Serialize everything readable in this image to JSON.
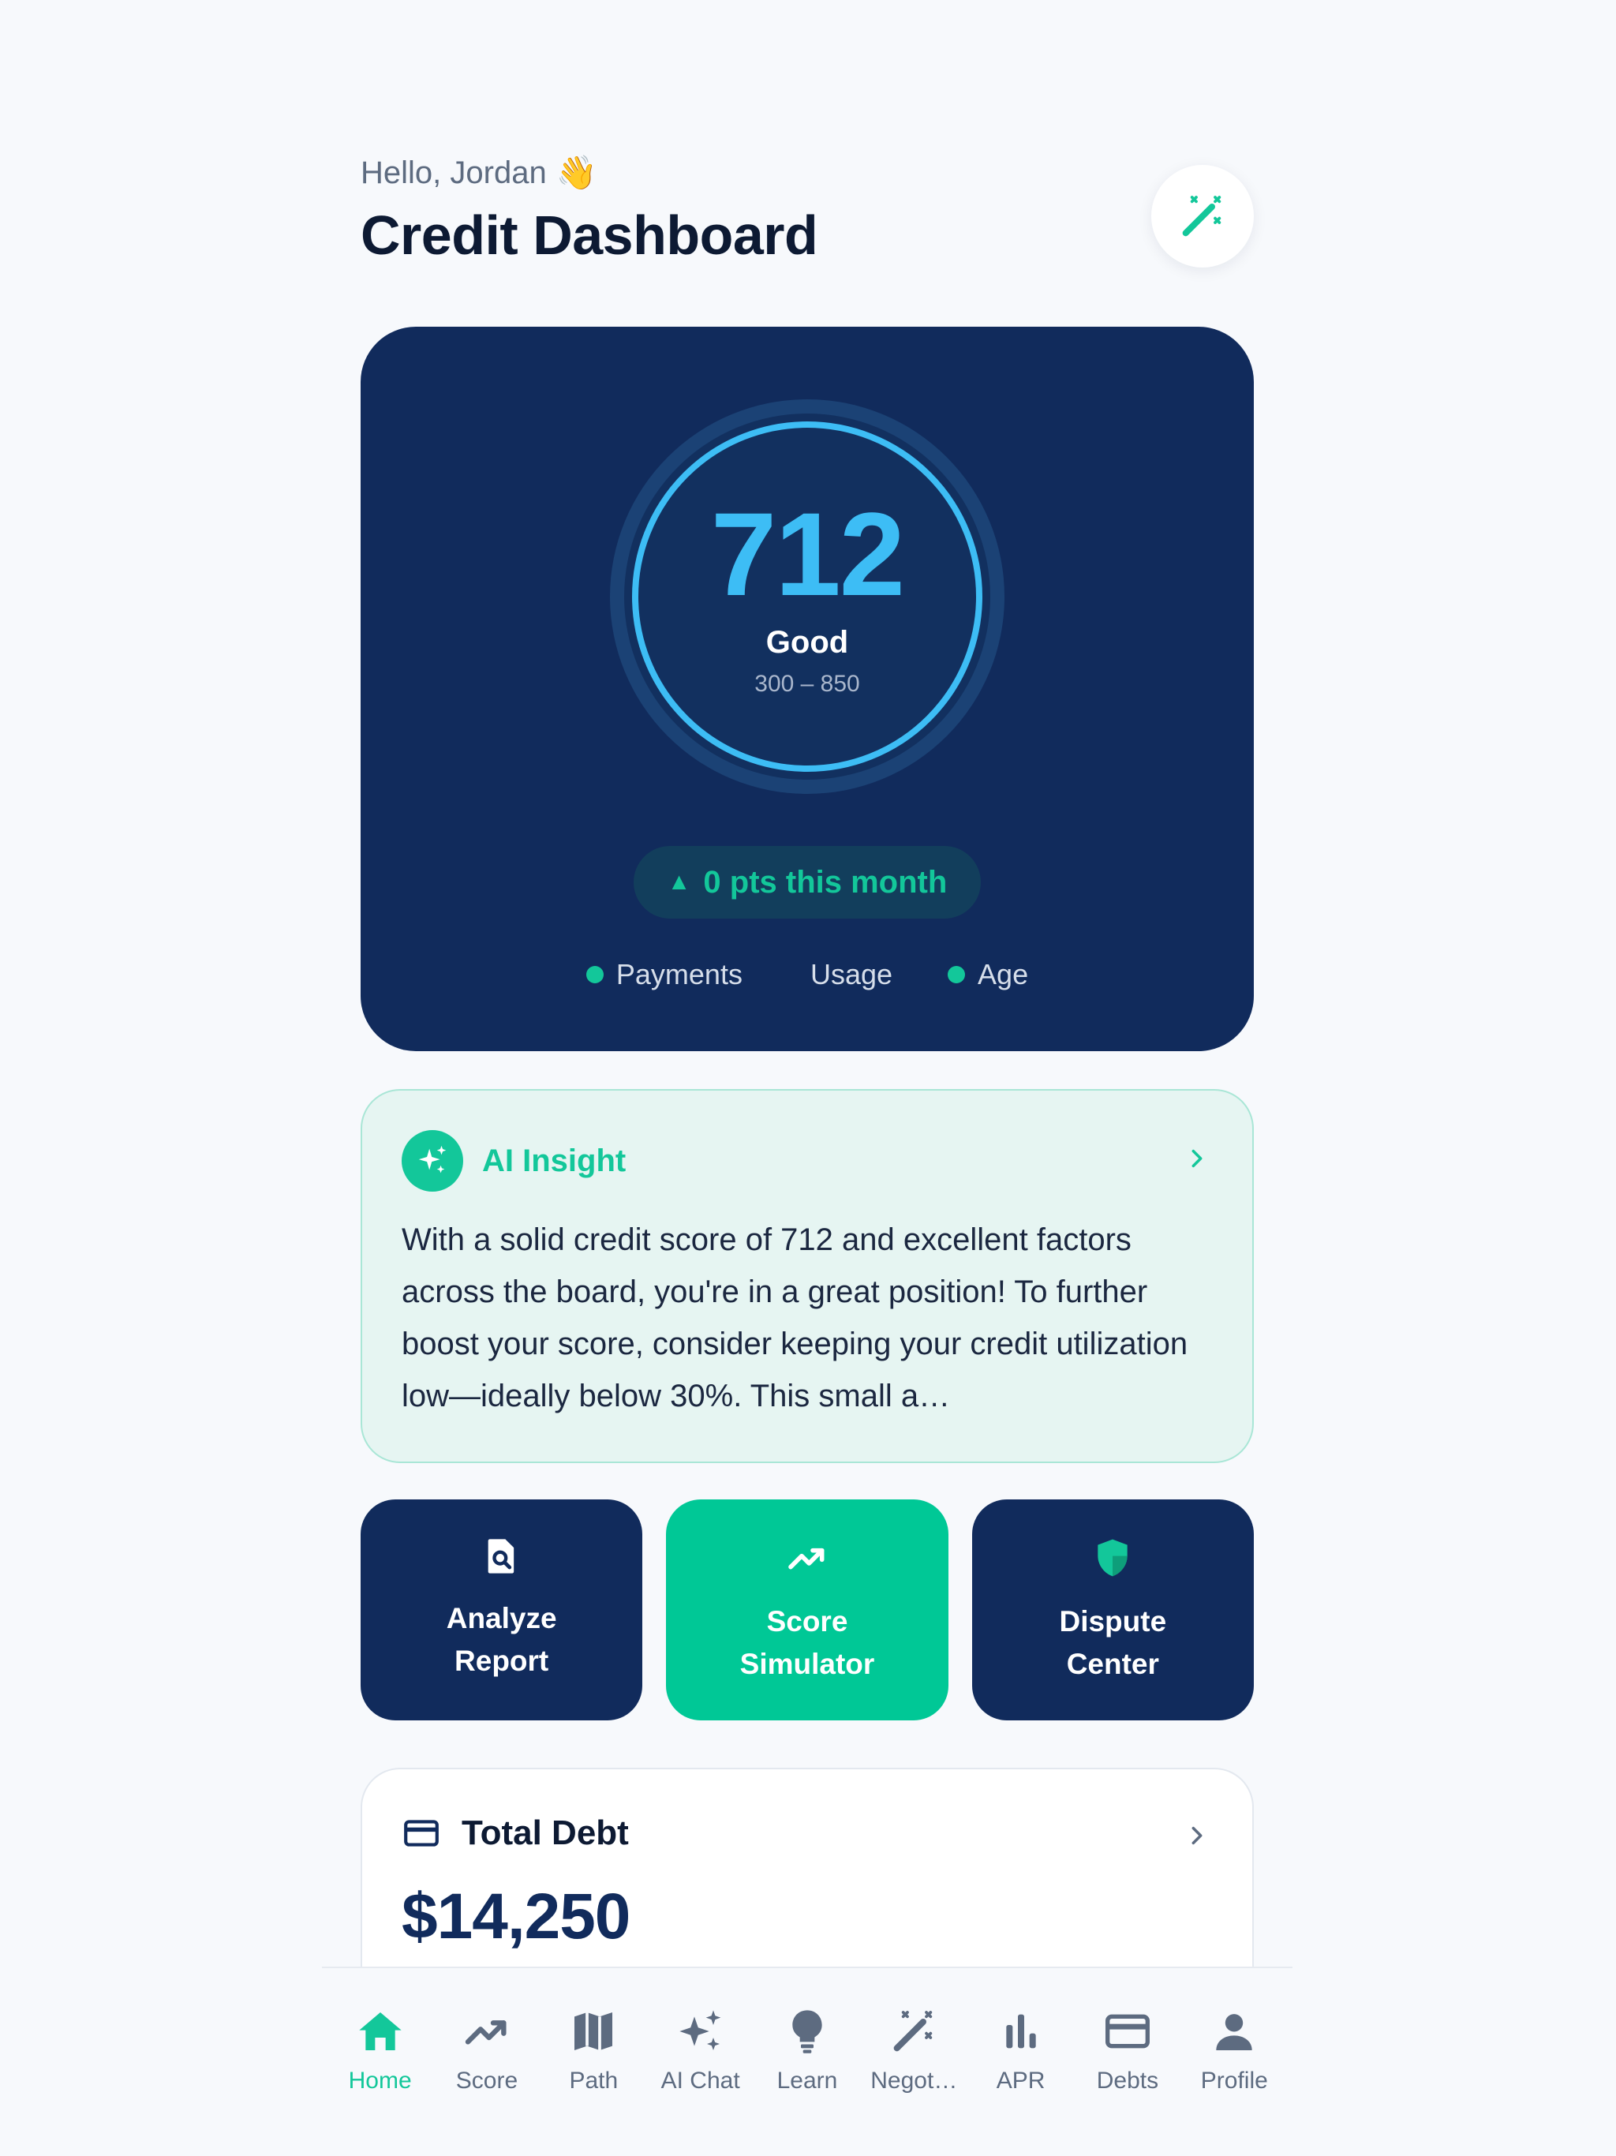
{
  "header": {
    "greeting": "Hello, Jordan",
    "greeting_emoji": "👋",
    "title": "Credit Dashboard",
    "action_icon": "magic-wand-icon"
  },
  "score": {
    "value": "712",
    "rating": "Good",
    "range": "300 – 850",
    "min": 300,
    "max": 850,
    "delta_text": "0 pts this month",
    "delta_icon": "▲",
    "factors": [
      {
        "label": "Payments",
        "dot": true
      },
      {
        "label": "Usage",
        "dot": false
      },
      {
        "label": "Age",
        "dot": true
      }
    ]
  },
  "insight": {
    "title": "AI Insight",
    "text": "With a solid credit score of 712 and excellent factors across the board, you're in a great position! To further boost your score, consider keeping your credit utilization low—ideally below 30%. This small a…"
  },
  "actions": [
    {
      "label": "Analyze Report",
      "icon": "document-search-icon"
    },
    {
      "label": "Score Simulator",
      "icon": "trending-up-icon"
    },
    {
      "label": "Dispute Center",
      "icon": "shield-icon"
    }
  ],
  "debt": {
    "title": "Total Debt",
    "amount": "$14,250"
  },
  "nav": [
    {
      "label": "Home",
      "icon": "home-icon"
    },
    {
      "label": "Score",
      "icon": "trending-up-icon"
    },
    {
      "label": "Path",
      "icon": "map-icon"
    },
    {
      "label": "AI Chat",
      "icon": "sparkles-icon"
    },
    {
      "label": "Learn",
      "icon": "lightbulb-icon"
    },
    {
      "label": "Negot…",
      "icon": "magic-wand-icon"
    },
    {
      "label": "APR",
      "icon": "bar-chart-icon"
    },
    {
      "label": "Debts",
      "icon": "credit-card-icon"
    },
    {
      "label": "Profile",
      "icon": "person-icon"
    }
  ],
  "colors": {
    "navy": "#112b5c",
    "green": "#13c79a",
    "score_blue": "#3dbdf5"
  }
}
